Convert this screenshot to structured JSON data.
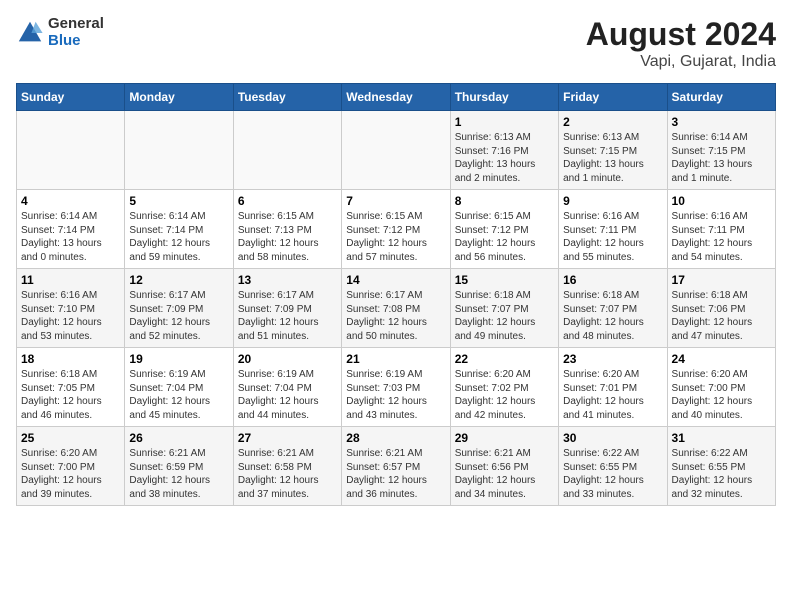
{
  "header": {
    "logo_general": "General",
    "logo_blue": "Blue",
    "title": "August 2024",
    "subtitle": "Vapi, Gujarat, India"
  },
  "days_of_week": [
    "Sunday",
    "Monday",
    "Tuesday",
    "Wednesday",
    "Thursday",
    "Friday",
    "Saturday"
  ],
  "weeks": [
    [
      {
        "day": "",
        "content": ""
      },
      {
        "day": "",
        "content": ""
      },
      {
        "day": "",
        "content": ""
      },
      {
        "day": "",
        "content": ""
      },
      {
        "day": "1",
        "content": "Sunrise: 6:13 AM\nSunset: 7:16 PM\nDaylight: 13 hours\nand 2 minutes."
      },
      {
        "day": "2",
        "content": "Sunrise: 6:13 AM\nSunset: 7:15 PM\nDaylight: 13 hours\nand 1 minute."
      },
      {
        "day": "3",
        "content": "Sunrise: 6:14 AM\nSunset: 7:15 PM\nDaylight: 13 hours\nand 1 minute."
      }
    ],
    [
      {
        "day": "4",
        "content": "Sunrise: 6:14 AM\nSunset: 7:14 PM\nDaylight: 13 hours\nand 0 minutes."
      },
      {
        "day": "5",
        "content": "Sunrise: 6:14 AM\nSunset: 7:14 PM\nDaylight: 12 hours\nand 59 minutes."
      },
      {
        "day": "6",
        "content": "Sunrise: 6:15 AM\nSunset: 7:13 PM\nDaylight: 12 hours\nand 58 minutes."
      },
      {
        "day": "7",
        "content": "Sunrise: 6:15 AM\nSunset: 7:12 PM\nDaylight: 12 hours\nand 57 minutes."
      },
      {
        "day": "8",
        "content": "Sunrise: 6:15 AM\nSunset: 7:12 PM\nDaylight: 12 hours\nand 56 minutes."
      },
      {
        "day": "9",
        "content": "Sunrise: 6:16 AM\nSunset: 7:11 PM\nDaylight: 12 hours\nand 55 minutes."
      },
      {
        "day": "10",
        "content": "Sunrise: 6:16 AM\nSunset: 7:11 PM\nDaylight: 12 hours\nand 54 minutes."
      }
    ],
    [
      {
        "day": "11",
        "content": "Sunrise: 6:16 AM\nSunset: 7:10 PM\nDaylight: 12 hours\nand 53 minutes."
      },
      {
        "day": "12",
        "content": "Sunrise: 6:17 AM\nSunset: 7:09 PM\nDaylight: 12 hours\nand 52 minutes."
      },
      {
        "day": "13",
        "content": "Sunrise: 6:17 AM\nSunset: 7:09 PM\nDaylight: 12 hours\nand 51 minutes."
      },
      {
        "day": "14",
        "content": "Sunrise: 6:17 AM\nSunset: 7:08 PM\nDaylight: 12 hours\nand 50 minutes."
      },
      {
        "day": "15",
        "content": "Sunrise: 6:18 AM\nSunset: 7:07 PM\nDaylight: 12 hours\nand 49 minutes."
      },
      {
        "day": "16",
        "content": "Sunrise: 6:18 AM\nSunset: 7:07 PM\nDaylight: 12 hours\nand 48 minutes."
      },
      {
        "day": "17",
        "content": "Sunrise: 6:18 AM\nSunset: 7:06 PM\nDaylight: 12 hours\nand 47 minutes."
      }
    ],
    [
      {
        "day": "18",
        "content": "Sunrise: 6:18 AM\nSunset: 7:05 PM\nDaylight: 12 hours\nand 46 minutes."
      },
      {
        "day": "19",
        "content": "Sunrise: 6:19 AM\nSunset: 7:04 PM\nDaylight: 12 hours\nand 45 minutes."
      },
      {
        "day": "20",
        "content": "Sunrise: 6:19 AM\nSunset: 7:04 PM\nDaylight: 12 hours\nand 44 minutes."
      },
      {
        "day": "21",
        "content": "Sunrise: 6:19 AM\nSunset: 7:03 PM\nDaylight: 12 hours\nand 43 minutes."
      },
      {
        "day": "22",
        "content": "Sunrise: 6:20 AM\nSunset: 7:02 PM\nDaylight: 12 hours\nand 42 minutes."
      },
      {
        "day": "23",
        "content": "Sunrise: 6:20 AM\nSunset: 7:01 PM\nDaylight: 12 hours\nand 41 minutes."
      },
      {
        "day": "24",
        "content": "Sunrise: 6:20 AM\nSunset: 7:00 PM\nDaylight: 12 hours\nand 40 minutes."
      }
    ],
    [
      {
        "day": "25",
        "content": "Sunrise: 6:20 AM\nSunset: 7:00 PM\nDaylight: 12 hours\nand 39 minutes."
      },
      {
        "day": "26",
        "content": "Sunrise: 6:21 AM\nSunset: 6:59 PM\nDaylight: 12 hours\nand 38 minutes."
      },
      {
        "day": "27",
        "content": "Sunrise: 6:21 AM\nSunset: 6:58 PM\nDaylight: 12 hours\nand 37 minutes."
      },
      {
        "day": "28",
        "content": "Sunrise: 6:21 AM\nSunset: 6:57 PM\nDaylight: 12 hours\nand 36 minutes."
      },
      {
        "day": "29",
        "content": "Sunrise: 6:21 AM\nSunset: 6:56 PM\nDaylight: 12 hours\nand 34 minutes."
      },
      {
        "day": "30",
        "content": "Sunrise: 6:22 AM\nSunset: 6:55 PM\nDaylight: 12 hours\nand 33 minutes."
      },
      {
        "day": "31",
        "content": "Sunrise: 6:22 AM\nSunset: 6:55 PM\nDaylight: 12 hours\nand 32 minutes."
      }
    ]
  ]
}
